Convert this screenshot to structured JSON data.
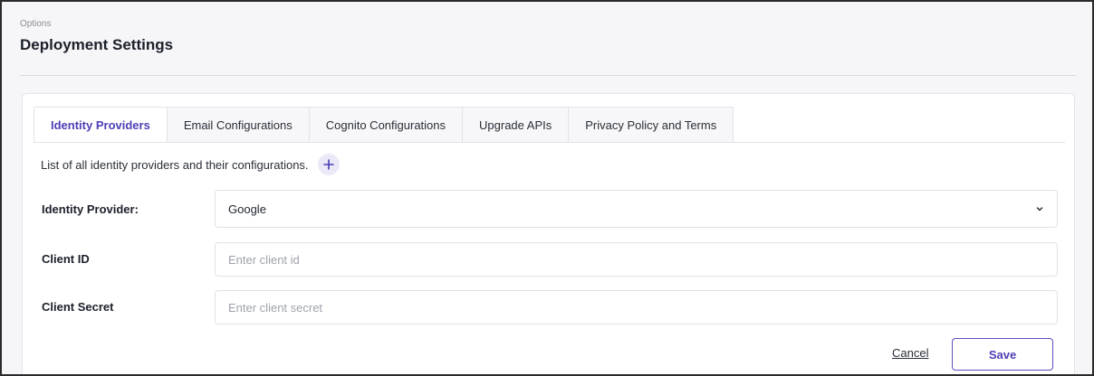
{
  "header": {
    "breadcrumb": "Options",
    "title": "Deployment Settings"
  },
  "tabs": [
    {
      "label": "Identity Providers",
      "active": true
    },
    {
      "label": "Email Configurations",
      "active": false
    },
    {
      "label": "Cognito Configurations",
      "active": false
    },
    {
      "label": "Upgrade APIs",
      "active": false
    },
    {
      "label": "Privacy Policy and Terms",
      "active": false
    }
  ],
  "description": "List of all identity providers and their configurations.",
  "add_icon": "plus-icon",
  "form": {
    "provider_label": "Identity Provider:",
    "provider_value": "Google",
    "provider_icon": "chevron-down-icon",
    "client_id_label": "Client ID",
    "client_id_value": "",
    "client_id_placeholder": "Enter client id",
    "client_secret_label": "Client Secret",
    "client_secret_value": "",
    "client_secret_placeholder": "Enter client secret"
  },
  "actions": {
    "cancel_label": "Cancel",
    "save_label": "Save"
  },
  "colors": {
    "accent": "#4a3fb5",
    "accent_light": "#ebe9f8",
    "border": "#e1e2e7"
  }
}
